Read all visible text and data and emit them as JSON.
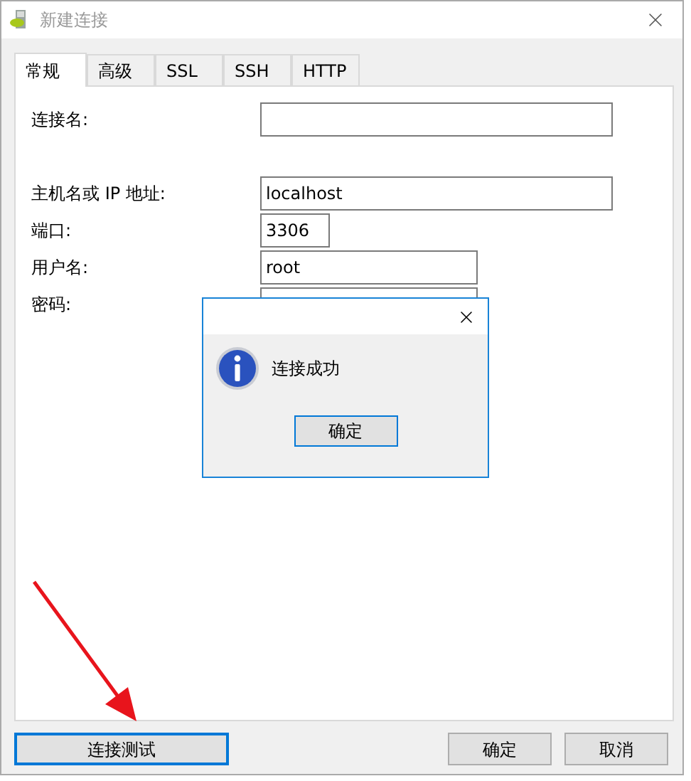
{
  "window": {
    "title": "新建连接"
  },
  "tabs": [
    {
      "label": "常规",
      "selected": true
    },
    {
      "label": "高级",
      "selected": false
    },
    {
      "label": "SSL",
      "selected": false
    },
    {
      "label": "SSH",
      "selected": false
    },
    {
      "label": "HTTP",
      "selected": false
    }
  ],
  "fields": [
    {
      "label": "连接名:"
    },
    {
      "label": "主机名或 IP 地址:",
      "value": "localhost"
    },
    {
      "label": "端口:",
      "value": "3306"
    },
    {
      "label": "用户名:",
      "value": "root"
    },
    {
      "label": "密码:"
    }
  ],
  "dialog": {
    "message": "连接成功",
    "button": "确定"
  },
  "buttons": [
    {
      "label": "连接测试",
      "kind": "left",
      "focused": true
    },
    {
      "label": "确定",
      "kind": "right",
      "focused": false
    },
    {
      "label": "取消",
      "kind": "right",
      "focused": false
    }
  ]
}
